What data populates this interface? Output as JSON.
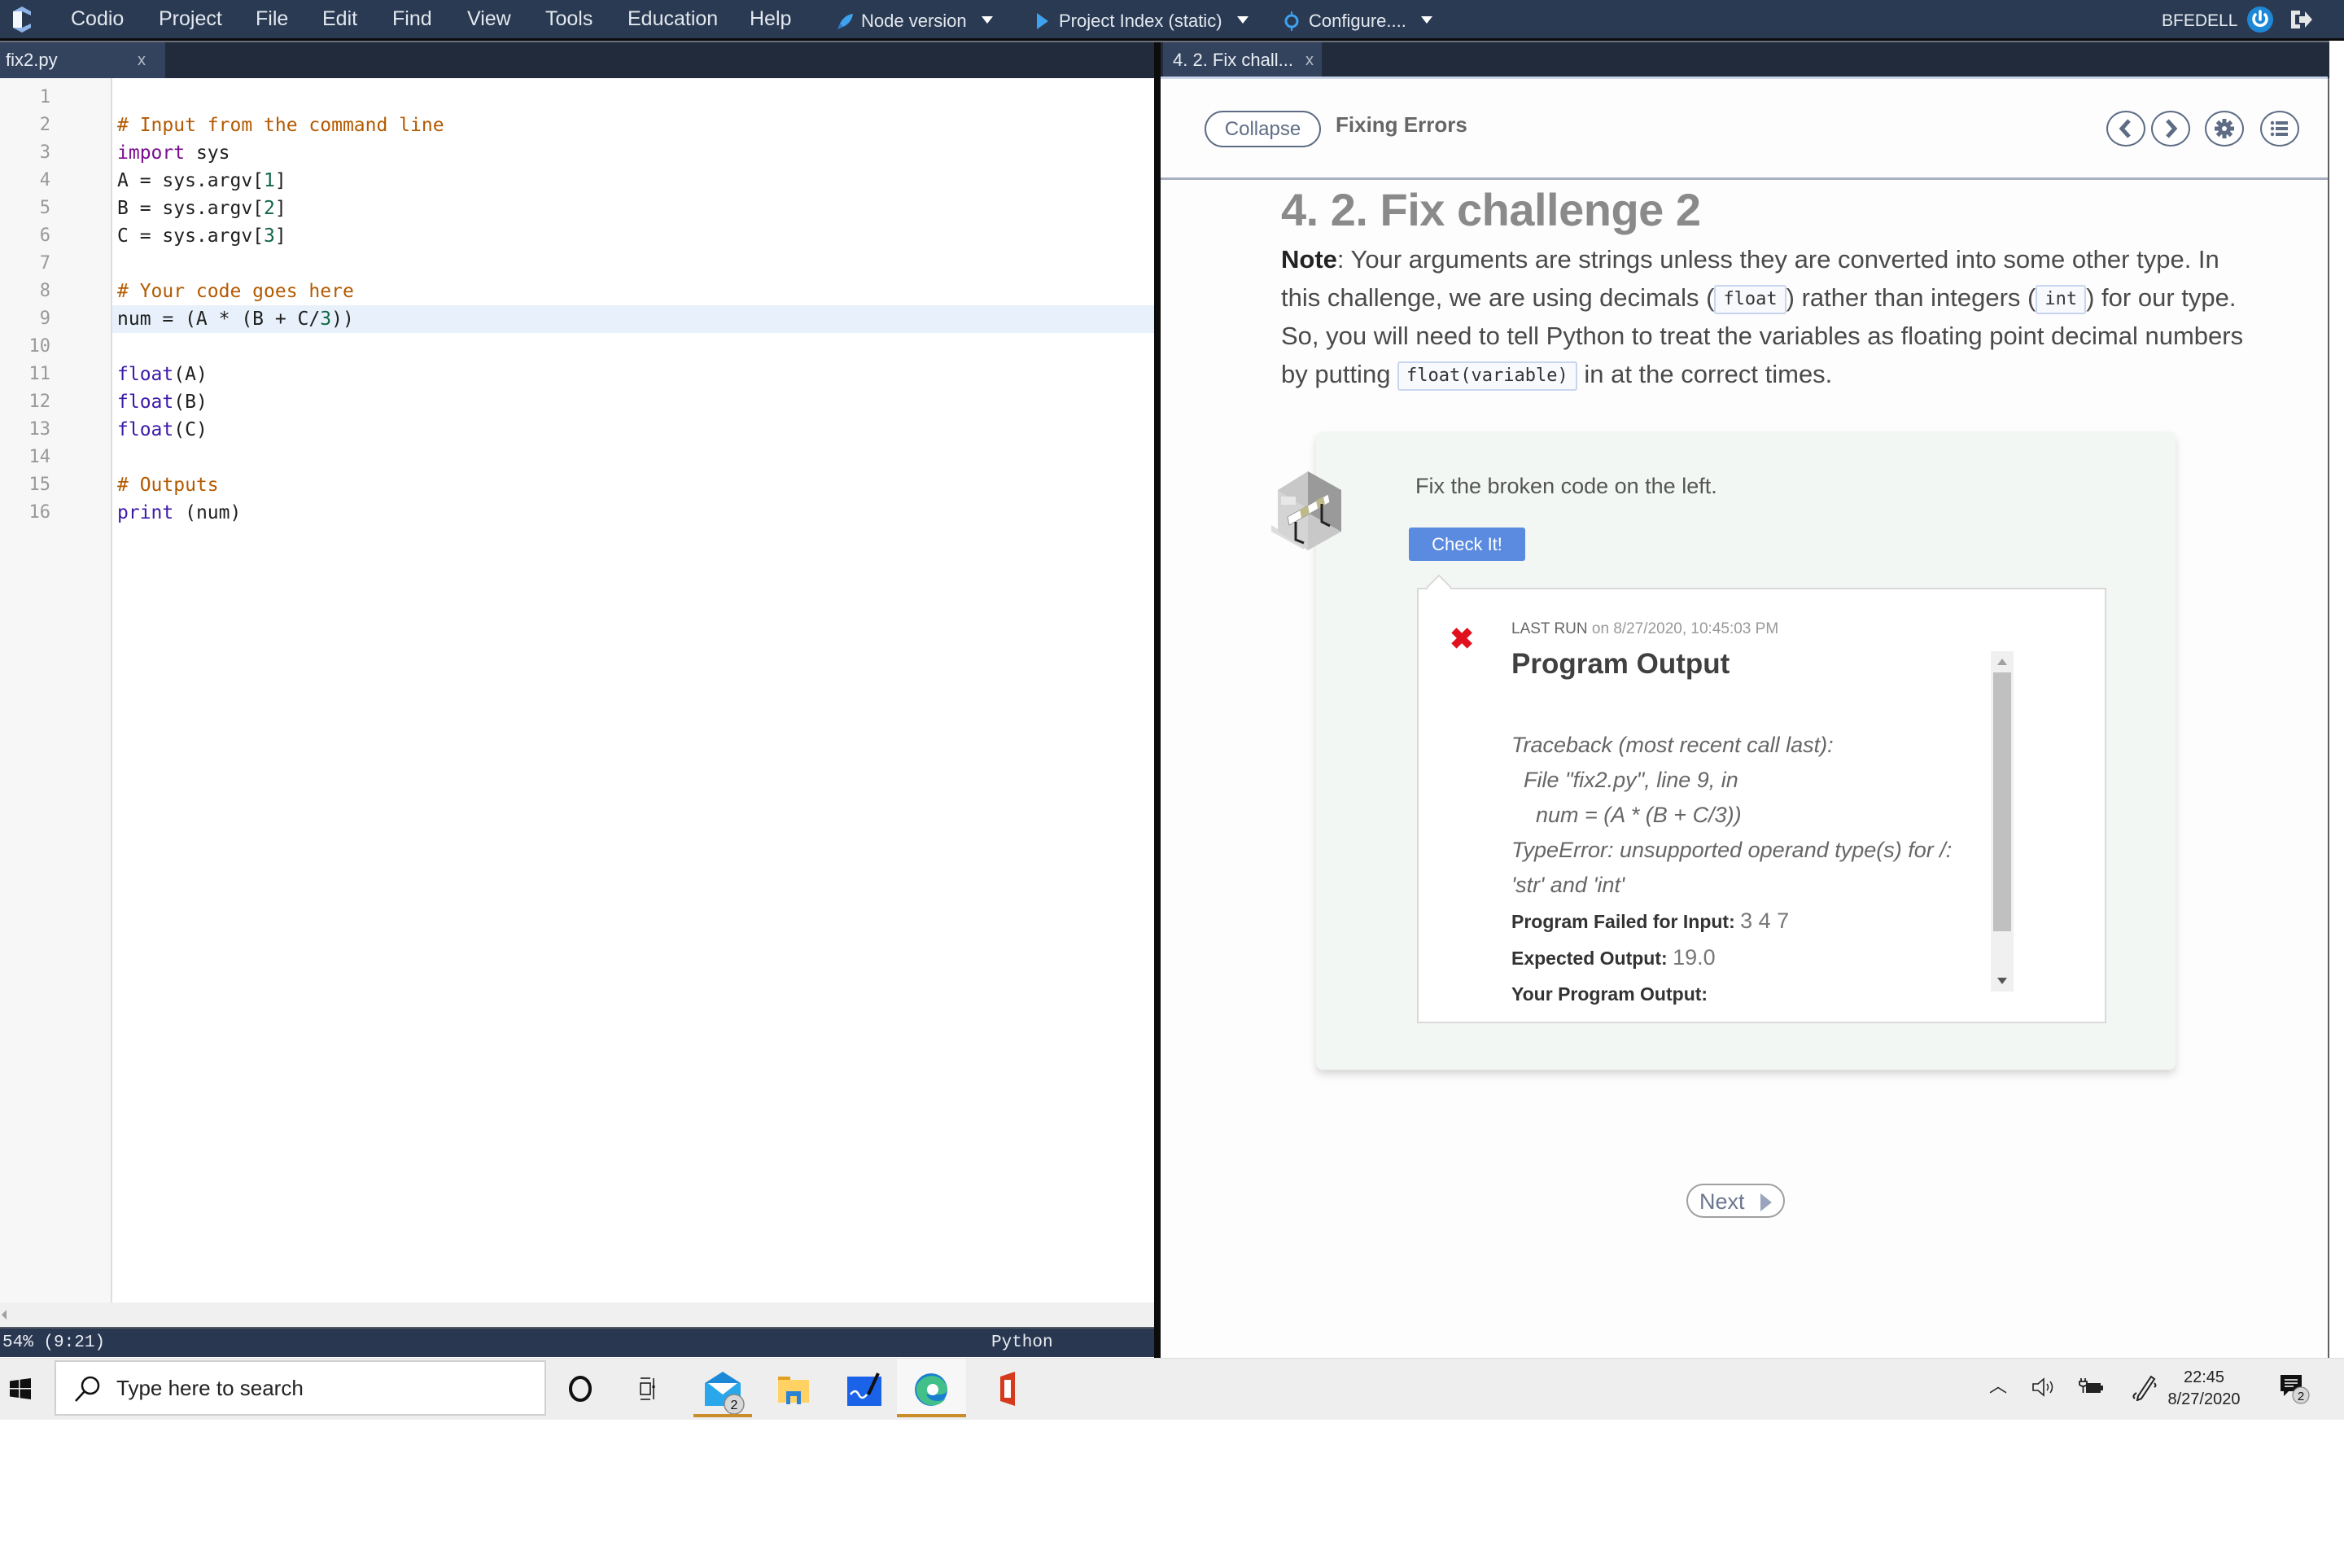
{
  "menubar": {
    "items": [
      "Codio",
      "Project",
      "File",
      "Edit",
      "Find",
      "View",
      "Tools",
      "Education",
      "Help"
    ],
    "tools": [
      {
        "label": "Node version",
        "icon": "rocket-icon"
      },
      {
        "label": "Project Index (static)",
        "icon": "play-icon"
      },
      {
        "label": "Configure....",
        "icon": "target-icon"
      }
    ],
    "user": "BFEDELL"
  },
  "editor": {
    "tab_label": "fix2.py",
    "tab_close": "x",
    "active_line": 9,
    "lines": [
      "",
      "# Input from the command line",
      "import sys",
      "A = sys.argv[1]",
      "B = sys.argv[2]",
      "C = sys.argv[3]",
      "",
      "# Your code goes here",
      "num = (A * (B + C/3))",
      "",
      "float(A)",
      "float(B)",
      "float(C)",
      "",
      "# Outputs",
      "print (num)"
    ],
    "status_left": "54%  (9:21)",
    "status_right": "Python"
  },
  "guide": {
    "tab_label": "4. 2. Fix chall...",
    "tab_close": "x",
    "collapse_label": "Collapse",
    "title": "Fixing Errors",
    "heading": "4. 2. Fix challenge 2",
    "note": {
      "bold": "Note",
      "p1": ": Your arguments are strings unless they are converted into some other type. In this challenge, we are using decimals (",
      "code1": "float",
      "p2": ") rather than integers (",
      "code2": "int",
      "p3": ") for our type. So, you will need to tell Python to treat the variables as floating point decimal numbers by putting ",
      "code3": "float(variable)",
      "p4": " in at the correct times."
    },
    "challenge": {
      "instructions": "Fix the broken code on the left.",
      "check_label": "Check It!",
      "last_run_label": "LAST RUN",
      "last_run_time": "on 8/27/2020, 10:45:03 PM",
      "output_title": "Program Output",
      "traceback": [
        "Traceback (most recent call last):",
        "  File \"fix2.py\", line 9, in",
        "    num = (A * (B + C/3))",
        "TypeError: unsupported operand type(s) for /:",
        "'str' and 'int'"
      ],
      "failed_input_label": "Program Failed for Input:",
      "failed_input_value": "3 4 7",
      "expected_label": "Expected Output:",
      "expected_value": "19.0",
      "your_output_label": "Your Program Output:",
      "status": "failed"
    },
    "next_label": "Next"
  },
  "taskbar": {
    "search_placeholder": "Type here to search",
    "mail_badge": "2",
    "time": "22:45",
    "date": "8/27/2020",
    "notifications_badge": "2"
  },
  "colors": {
    "menubar_bg": "#2a3a52",
    "accent_blue": "#5a8be0",
    "error_red": "#e0101c",
    "comment": "#b35a00",
    "keyword": "#7a0f8f"
  }
}
